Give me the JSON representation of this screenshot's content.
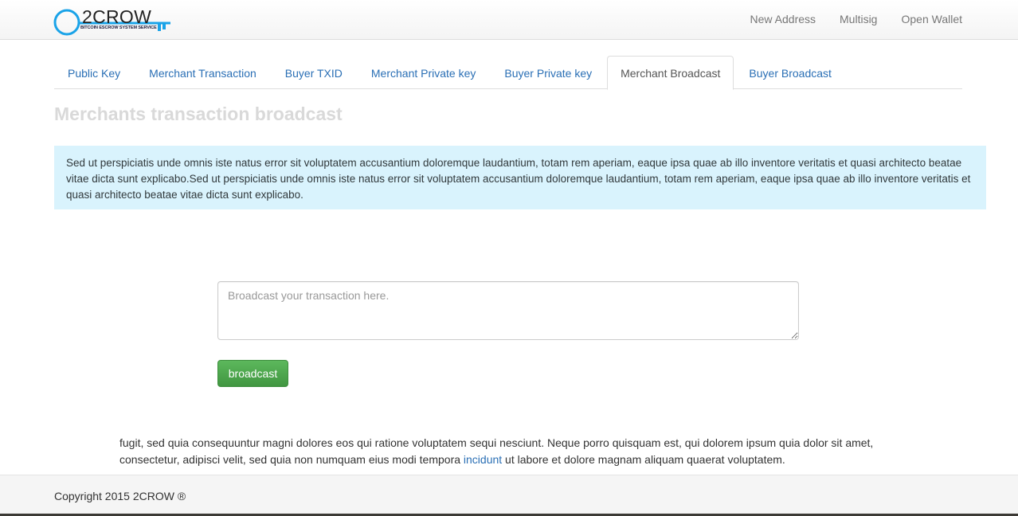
{
  "brand": {
    "name": "2CROW",
    "tagline": "BITCOIN ESCROW SYSTEM SERVICE",
    "accent_color": "#1aa3e8"
  },
  "nav": {
    "links": [
      "New Address",
      "Multisig",
      "Open Wallet"
    ]
  },
  "tabs": {
    "items": [
      "Public Key",
      "Merchant Transaction",
      "Buyer TXID",
      "Merchant Private key",
      "Buyer Private key",
      "Merchant Broadcast",
      "Buyer Broadcast"
    ],
    "active": "Merchant Broadcast"
  },
  "main": {
    "heading": "Merchants transaction broadcast",
    "info_text": "Sed ut perspiciatis unde omnis iste natus error sit voluptatem accusantium doloremque laudantium, totam rem aperiam, eaque ipsa quae ab illo inventore veritatis et quasi architecto beatae vitae dicta sunt explicabo.Sed ut perspiciatis unde omnis iste natus error sit voluptatem accusantium doloremque laudantium, totam rem aperiam, eaque ipsa quae ab illo inventore veritatis et quasi architecto beatae vitae dicta sunt explicabo.",
    "textarea_placeholder": "Broadcast your transaction here.",
    "textarea_value": "",
    "button_label": "broadcast",
    "body_text_before": "fugit, sed quia consequuntur magni dolores eos qui ratione voluptatem sequi nesciunt. Neque porro quisquam est, qui dolorem ipsum quia dolor sit amet, consectetur, adipisci velit, sed quia non numquam eius modi tempora ",
    "body_link": "incidunt",
    "body_text_after": " ut labore et dolore magnam aliquam quaerat voluptatem."
  },
  "footer": {
    "copyright": "Copyright 2015 2CROW ®"
  }
}
